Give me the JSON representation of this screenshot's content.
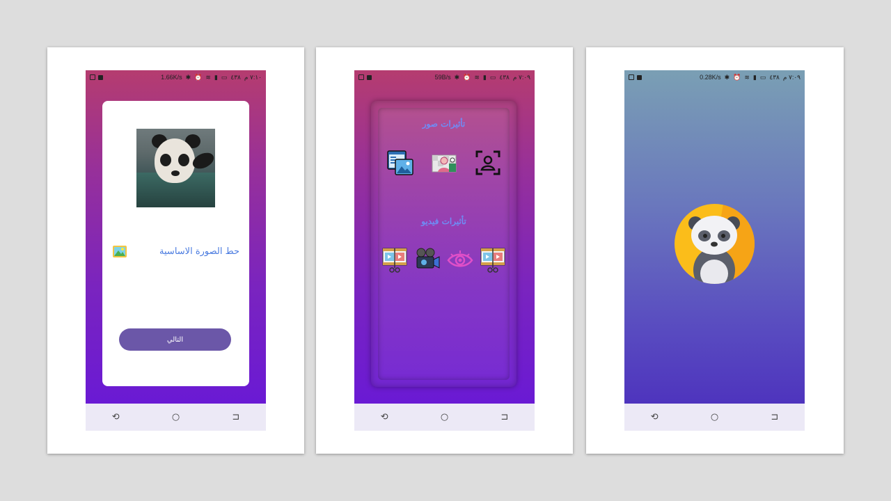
{
  "status_bar": {
    "time": "٧:١٠ م",
    "time_2": "٧:٠٩ م",
    "date": "٤٣٨",
    "speeds": [
      "1.66K/s",
      "59B/s",
      "0.28K/s"
    ]
  },
  "screen_pick": {
    "pick_label": "حط الصورة الاساسية",
    "next_label": "التالي"
  },
  "screen_effects": {
    "photo_section_title": "تأثيرات صور",
    "video_section_title": "تأثيرات فيديو",
    "photo_items": [
      {
        "label": "",
        "icon": "face-scan-icon"
      },
      {
        "label": "",
        "icon": "image-edit-icon"
      },
      {
        "label": "",
        "icon": "gallery-window-icon"
      }
    ],
    "video_items": [
      {
        "label": "",
        "icon": "film-cut-icon"
      },
      {
        "label": "",
        "icon": "eye-icon"
      },
      {
        "label": "",
        "icon": "video-camera-icon"
      },
      {
        "label": "",
        "icon": "film-cut-icon"
      }
    ]
  },
  "screen_splash": {
    "logo": "panda-logo-icon"
  },
  "colors": {
    "accent": "#6b57a8",
    "title_blue": "#6f8cf5",
    "pick_label": "#4a7be0",
    "logo_yellow": "#fbbd1a"
  }
}
